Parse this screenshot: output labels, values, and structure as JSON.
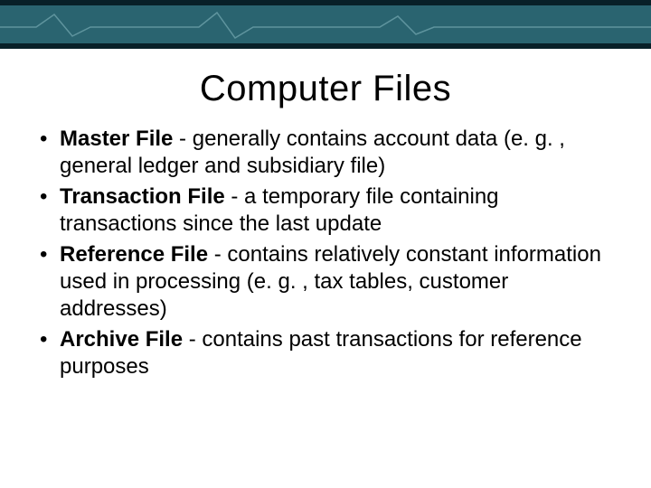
{
  "title": "Computer Files",
  "bullets": [
    {
      "term": "Master File",
      "desc": " - generally contains account data (e. g. , general ledger and subsidiary file)"
    },
    {
      "term": "Transaction File",
      "desc": " - a temporary file containing transactions since the last update"
    },
    {
      "term": "Reference File",
      "desc": " - contains relatively constant information used in processing (e. g. , tax tables, customer addresses)"
    },
    {
      "term": "Archive File",
      "desc": " - contains past transactions for reference purposes"
    }
  ]
}
